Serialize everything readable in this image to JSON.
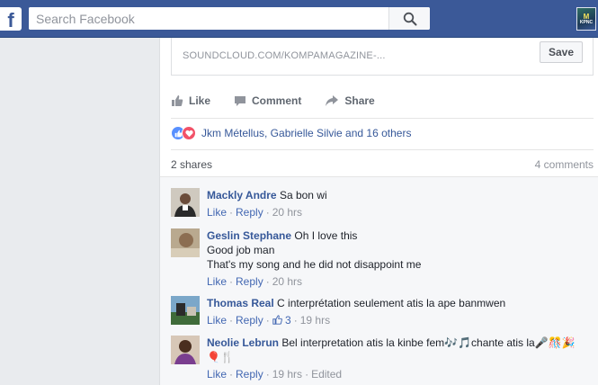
{
  "topbar": {
    "logo_letter": "f",
    "search_placeholder": "Search Facebook",
    "profile_badge_top": "M",
    "profile_badge_bottom": "KPNC"
  },
  "post": {
    "link_domain": "SOUNDCLOUD.COM/KOMPAMAGAZINE-...",
    "save_label": "Save",
    "actions": {
      "like": "Like",
      "comment": "Comment",
      "share": "Share"
    },
    "reactions_text": "Jkm Métellus, Gabrielle Silvie and 16 others",
    "shares": "2 shares",
    "comments_count": "4 comments"
  },
  "comments": [
    {
      "name": "Mackly Andre",
      "lines": [
        "Sa bon wi"
      ],
      "like": "Like",
      "reply": "Reply",
      "time": "20 hrs"
    },
    {
      "name": "Geslin Stephane",
      "lines": [
        "Oh I love this",
        "Good job man",
        "That's my song and he did not disappoint me"
      ],
      "like": "Like",
      "reply": "Reply",
      "time": "20 hrs"
    },
    {
      "name": "Thomas Real",
      "lines": [
        "C interprétation seulement atis la ape banmwen"
      ],
      "like": "Like",
      "reply": "Reply",
      "likes": "3",
      "time": "19 hrs"
    },
    {
      "name": "Neolie Lebrun",
      "lines": [
        "Bel interpretation atis la kinbe fem",
        "chante atis la",
        "🎈🍴"
      ],
      "emoji_a": "🎶🎵",
      "emoji_b": "🎤🎊🎉",
      "like": "Like",
      "reply": "Reply",
      "time": "19 hrs",
      "edited": "Edited"
    }
  ],
  "colors": {
    "brand": "#3b5998",
    "link": "#365899",
    "meta": "#90949c"
  }
}
